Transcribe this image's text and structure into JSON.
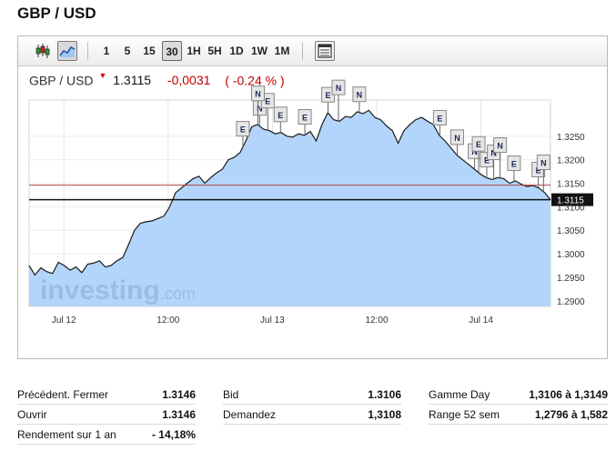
{
  "page": {
    "title": "GBP / USD"
  },
  "toolbar": {
    "icons": [
      "candlestick-chart-icon",
      "area-chart-icon"
    ],
    "intervals": [
      "1",
      "5",
      "15",
      "30",
      "1H",
      "5H",
      "1D",
      "1W",
      "1M"
    ],
    "active_interval": "30"
  },
  "quote": {
    "symbol": "GBP / USD",
    "direction_arrow": "▼",
    "price": "1.3115",
    "change": "-0,0031",
    "change_pct": "( -0.24 % )"
  },
  "colors": {
    "area_fill": "#b3d5fb",
    "line": "#1a1a1a",
    "prev_close_line": "#b04040",
    "current_line": "#111111",
    "negative": "#c00000"
  },
  "chart_data": {
    "type": "area",
    "x_tick_labels": [
      "Jul 12",
      "12:00",
      "Jul 13",
      "12:00",
      "Jul 14"
    ],
    "y_tick_labels": [
      "1.3250",
      "1.3200",
      "1.3150",
      "1.3100",
      "1.3050",
      "1.3000",
      "1.2950",
      "1.2900"
    ],
    "ylim": [
      1.2888,
      1.3327
    ],
    "xlim": [
      0,
      90
    ],
    "x_ticks": [
      6,
      24,
      42,
      60,
      78
    ],
    "series": [
      {
        "values": [
          1.2975,
          1.2955,
          1.297,
          1.2962,
          1.2958,
          1.2982,
          1.2975,
          1.2965,
          1.2972,
          1.296,
          1.2978,
          1.298,
          1.2985,
          1.2972,
          1.2975,
          1.2985,
          1.2992,
          1.302,
          1.305,
          1.3065,
          1.3068,
          1.307,
          1.3075,
          1.308,
          1.31,
          1.313,
          1.314,
          1.315,
          1.316,
          1.3165,
          1.315,
          1.3162,
          1.3172,
          1.318,
          1.32,
          1.3205,
          1.3215,
          1.324,
          1.327,
          1.3275,
          1.3265,
          1.3262,
          1.3255,
          1.3258,
          1.325,
          1.3248,
          1.3255,
          1.3252,
          1.326,
          1.324,
          1.3275,
          1.33,
          1.3285,
          1.3282,
          1.3292,
          1.329,
          1.3302,
          1.3298,
          1.3305,
          1.329,
          1.3285,
          1.3272,
          1.3262,
          1.3235,
          1.3262,
          1.3275,
          1.3285,
          1.329,
          1.3282,
          1.3275,
          1.3252,
          1.324,
          1.3225,
          1.321,
          1.32,
          1.319,
          1.318,
          1.317,
          1.3162,
          1.3158,
          1.3162,
          1.316,
          1.315,
          1.3155,
          1.3148,
          1.3143,
          1.3145,
          1.314,
          1.313,
          1.3115
        ]
      }
    ],
    "reference_lines": [
      {
        "value": 1.3146,
        "type": "previous-close"
      },
      {
        "value": 1.3115,
        "type": "last-price",
        "label": "1.3115"
      }
    ],
    "event_markers": [
      {
        "x": 36.9,
        "label": "E"
      },
      {
        "x": 39.8,
        "label": "N"
      },
      {
        "x": 41.2,
        "label": "E"
      },
      {
        "x": 39.5,
        "label": "N"
      },
      {
        "x": 43.4,
        "label": "E"
      },
      {
        "x": 47.6,
        "label": "E"
      },
      {
        "x": 51.6,
        "label": "E"
      },
      {
        "x": 53.4,
        "label": "N"
      },
      {
        "x": 57.0,
        "label": "N"
      },
      {
        "x": 70.9,
        "label": "E"
      },
      {
        "x": 73.9,
        "label": "N"
      },
      {
        "x": 76.9,
        "label": "N"
      },
      {
        "x": 77.6,
        "label": "E"
      },
      {
        "x": 79.0,
        "label": "E"
      },
      {
        "x": 80.2,
        "label": "N"
      },
      {
        "x": 81.3,
        "label": "N"
      },
      {
        "x": 83.7,
        "label": "E"
      },
      {
        "x": 87.9,
        "label": "E"
      },
      {
        "x": 88.8,
        "label": "N"
      }
    ],
    "watermark": {
      "brand": "investing",
      "suffix": ".com"
    }
  },
  "stats": [
    [
      {
        "label": "Précédent. Fermer",
        "value": "1.3146"
      },
      {
        "label": "Ouvrir",
        "value": "1.3146"
      },
      {
        "label": "Rendement sur 1 an",
        "value": "- 14,18%"
      }
    ],
    [
      {
        "label": "Bid",
        "value": "1.3106"
      },
      {
        "label": "Demandez",
        "value": "1,3108"
      }
    ],
    [
      {
        "label": "Gamme Day",
        "value": "1,3106 à 1,3149"
      },
      {
        "label": "Range 52 sem",
        "value": "1,2796 à 1,582"
      }
    ]
  ]
}
